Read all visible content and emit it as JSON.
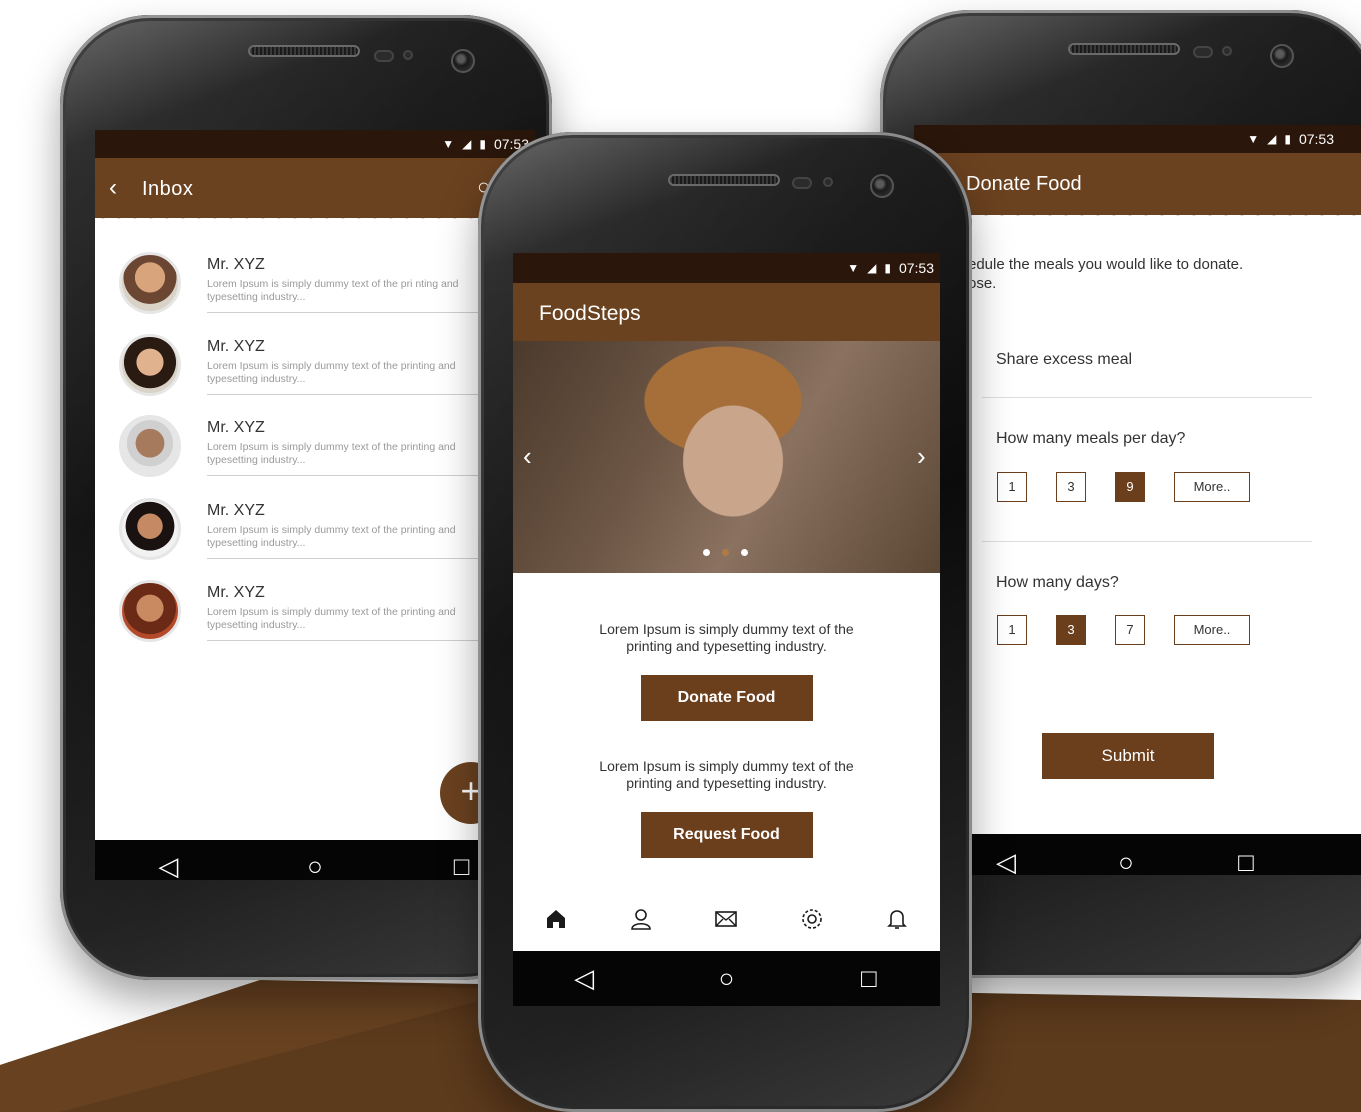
{
  "colors": {
    "brand_brown": "#6b4220",
    "button_brown": "#6b3e1c",
    "status_bar": "#2a160a",
    "floor": "#5c3a1c"
  },
  "status": {
    "time": "07:53",
    "icons": [
      "wifi-icon",
      "signal-icon",
      "battery-icon"
    ]
  },
  "inbox": {
    "back_glyph": "‹",
    "title": "Inbox",
    "messages": [
      {
        "name": "Mr. XYZ",
        "snippet": "Lorem Ipsum is simply dummy text of the pri nting and typesetting industry..."
      },
      {
        "name": "Mr. XYZ",
        "snippet": "Lorem Ipsum is simply dummy text of the printing and typesetting industry..."
      },
      {
        "name": "Mr. XYZ",
        "snippet": "Lorem Ipsum is simply dummy text of the printing and typesetting industry..."
      },
      {
        "name": "Mr. XYZ",
        "snippet": "Lorem Ipsum is simply dummy text of the printing and typesetting industry..."
      },
      {
        "name": "Mr. XYZ",
        "snippet": "Lorem Ipsum is simply dummy text of the printing and typesetting industry..."
      }
    ],
    "fab_glyph": "+"
  },
  "home": {
    "title": "FoodSteps",
    "carousel": {
      "prev_glyph": "‹",
      "next_glyph": "›",
      "slides": 3,
      "active_slide": 2
    },
    "donate_blurb": "Lorem Ipsum is simply dummy text of the printing and typesetting industry.",
    "donate_button": "Donate Food",
    "request_blurb": "Lorem Ipsum is simply dummy text of the printing and typesetting industry.",
    "request_button": "Request Food",
    "tabs": [
      "home-icon",
      "profile-icon",
      "mail-icon",
      "settings-icon",
      "bell-icon"
    ]
  },
  "donate": {
    "title": "Donate Food",
    "intro_line1": "edule the meals you would like to donate.",
    "intro_line2": "ose.",
    "share_label": "Share excess meal",
    "meals_question": "How many meals per day?",
    "meals_options": [
      "1",
      "3",
      "9",
      "More.."
    ],
    "meals_selected": "9",
    "days_question": "How many days?",
    "days_options": [
      "1",
      "3",
      "7",
      "More.."
    ],
    "days_selected": "3",
    "submit": "Submit"
  },
  "nav": {
    "back": "◁",
    "home": "○",
    "recents": "□"
  }
}
